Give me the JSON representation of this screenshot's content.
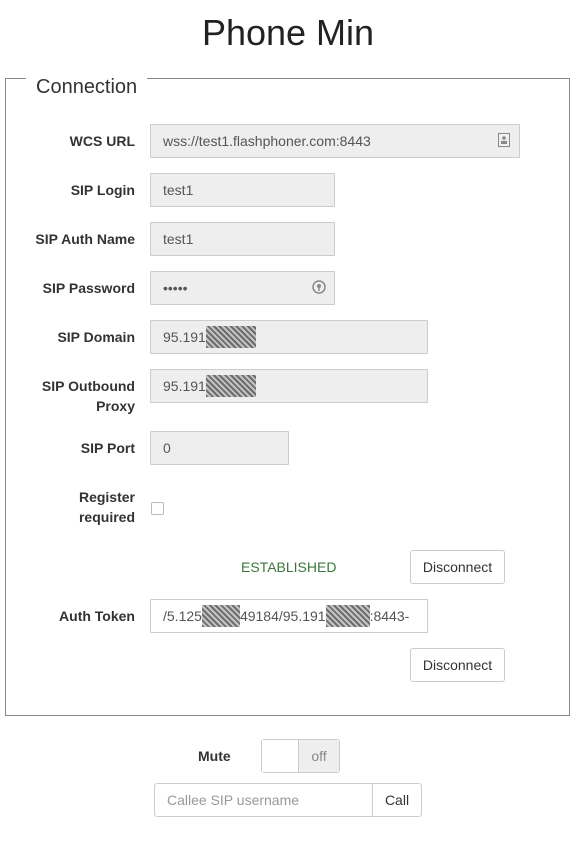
{
  "page": {
    "title": "Phone Min"
  },
  "connection": {
    "legend": "Connection",
    "wcs_url": {
      "label": "WCS URL",
      "value": "wss://test1.flashphoner.com:8443"
    },
    "sip_login": {
      "label": "SIP Login",
      "value": "test1"
    },
    "sip_auth_name": {
      "label": "SIP Auth Name",
      "value": "test1"
    },
    "sip_password": {
      "label": "SIP Password",
      "value": "•••••"
    },
    "sip_domain": {
      "label": "SIP Domain",
      "value": "95.191"
    },
    "sip_outbound_proxy": {
      "label_line1": "SIP Outbound",
      "label_line2": "Proxy",
      "value": "95.191"
    },
    "sip_port": {
      "label": "SIP Port",
      "value": "0"
    },
    "register_required": {
      "label_line1": "Register",
      "label_line2": "required",
      "checked": false
    },
    "status": "ESTABLISHED",
    "status_color": "#3c763d",
    "disconnect_label": "Disconnect",
    "auth_token": {
      "label": "Auth Token",
      "part1": "/5.125",
      "part2": "49184/95.191",
      "part3": ":8443-"
    },
    "disconnect2_label": "Disconnect"
  },
  "controls": {
    "mute_label": "Mute",
    "mute_state": "off",
    "callee_placeholder": "Callee SIP username",
    "call_label": "Call"
  }
}
